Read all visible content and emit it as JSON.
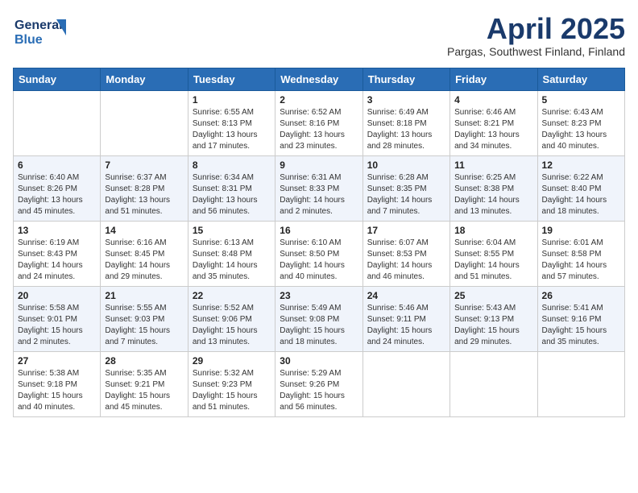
{
  "header": {
    "logo_line1": "General",
    "logo_line2": "Blue",
    "month": "April 2025",
    "location": "Pargas, Southwest Finland, Finland"
  },
  "days_of_week": [
    "Sunday",
    "Monday",
    "Tuesday",
    "Wednesday",
    "Thursday",
    "Friday",
    "Saturday"
  ],
  "weeks": [
    [
      {
        "day": "",
        "info": ""
      },
      {
        "day": "",
        "info": ""
      },
      {
        "day": "1",
        "info": "Sunrise: 6:55 AM\nSunset: 8:13 PM\nDaylight: 13 hours and 17 minutes."
      },
      {
        "day": "2",
        "info": "Sunrise: 6:52 AM\nSunset: 8:16 PM\nDaylight: 13 hours and 23 minutes."
      },
      {
        "day": "3",
        "info": "Sunrise: 6:49 AM\nSunset: 8:18 PM\nDaylight: 13 hours and 28 minutes."
      },
      {
        "day": "4",
        "info": "Sunrise: 6:46 AM\nSunset: 8:21 PM\nDaylight: 13 hours and 34 minutes."
      },
      {
        "day": "5",
        "info": "Sunrise: 6:43 AM\nSunset: 8:23 PM\nDaylight: 13 hours and 40 minutes."
      }
    ],
    [
      {
        "day": "6",
        "info": "Sunrise: 6:40 AM\nSunset: 8:26 PM\nDaylight: 13 hours and 45 minutes."
      },
      {
        "day": "7",
        "info": "Sunrise: 6:37 AM\nSunset: 8:28 PM\nDaylight: 13 hours and 51 minutes."
      },
      {
        "day": "8",
        "info": "Sunrise: 6:34 AM\nSunset: 8:31 PM\nDaylight: 13 hours and 56 minutes."
      },
      {
        "day": "9",
        "info": "Sunrise: 6:31 AM\nSunset: 8:33 PM\nDaylight: 14 hours and 2 minutes."
      },
      {
        "day": "10",
        "info": "Sunrise: 6:28 AM\nSunset: 8:35 PM\nDaylight: 14 hours and 7 minutes."
      },
      {
        "day": "11",
        "info": "Sunrise: 6:25 AM\nSunset: 8:38 PM\nDaylight: 14 hours and 13 minutes."
      },
      {
        "day": "12",
        "info": "Sunrise: 6:22 AM\nSunset: 8:40 PM\nDaylight: 14 hours and 18 minutes."
      }
    ],
    [
      {
        "day": "13",
        "info": "Sunrise: 6:19 AM\nSunset: 8:43 PM\nDaylight: 14 hours and 24 minutes."
      },
      {
        "day": "14",
        "info": "Sunrise: 6:16 AM\nSunset: 8:45 PM\nDaylight: 14 hours and 29 minutes."
      },
      {
        "day": "15",
        "info": "Sunrise: 6:13 AM\nSunset: 8:48 PM\nDaylight: 14 hours and 35 minutes."
      },
      {
        "day": "16",
        "info": "Sunrise: 6:10 AM\nSunset: 8:50 PM\nDaylight: 14 hours and 40 minutes."
      },
      {
        "day": "17",
        "info": "Sunrise: 6:07 AM\nSunset: 8:53 PM\nDaylight: 14 hours and 46 minutes."
      },
      {
        "day": "18",
        "info": "Sunrise: 6:04 AM\nSunset: 8:55 PM\nDaylight: 14 hours and 51 minutes."
      },
      {
        "day": "19",
        "info": "Sunrise: 6:01 AM\nSunset: 8:58 PM\nDaylight: 14 hours and 57 minutes."
      }
    ],
    [
      {
        "day": "20",
        "info": "Sunrise: 5:58 AM\nSunset: 9:01 PM\nDaylight: 15 hours and 2 minutes."
      },
      {
        "day": "21",
        "info": "Sunrise: 5:55 AM\nSunset: 9:03 PM\nDaylight: 15 hours and 7 minutes."
      },
      {
        "day": "22",
        "info": "Sunrise: 5:52 AM\nSunset: 9:06 PM\nDaylight: 15 hours and 13 minutes."
      },
      {
        "day": "23",
        "info": "Sunrise: 5:49 AM\nSunset: 9:08 PM\nDaylight: 15 hours and 18 minutes."
      },
      {
        "day": "24",
        "info": "Sunrise: 5:46 AM\nSunset: 9:11 PM\nDaylight: 15 hours and 24 minutes."
      },
      {
        "day": "25",
        "info": "Sunrise: 5:43 AM\nSunset: 9:13 PM\nDaylight: 15 hours and 29 minutes."
      },
      {
        "day": "26",
        "info": "Sunrise: 5:41 AM\nSunset: 9:16 PM\nDaylight: 15 hours and 35 minutes."
      }
    ],
    [
      {
        "day": "27",
        "info": "Sunrise: 5:38 AM\nSunset: 9:18 PM\nDaylight: 15 hours and 40 minutes."
      },
      {
        "day": "28",
        "info": "Sunrise: 5:35 AM\nSunset: 9:21 PM\nDaylight: 15 hours and 45 minutes."
      },
      {
        "day": "29",
        "info": "Sunrise: 5:32 AM\nSunset: 9:23 PM\nDaylight: 15 hours and 51 minutes."
      },
      {
        "day": "30",
        "info": "Sunrise: 5:29 AM\nSunset: 9:26 PM\nDaylight: 15 hours and 56 minutes."
      },
      {
        "day": "",
        "info": ""
      },
      {
        "day": "",
        "info": ""
      },
      {
        "day": "",
        "info": ""
      }
    ]
  ]
}
